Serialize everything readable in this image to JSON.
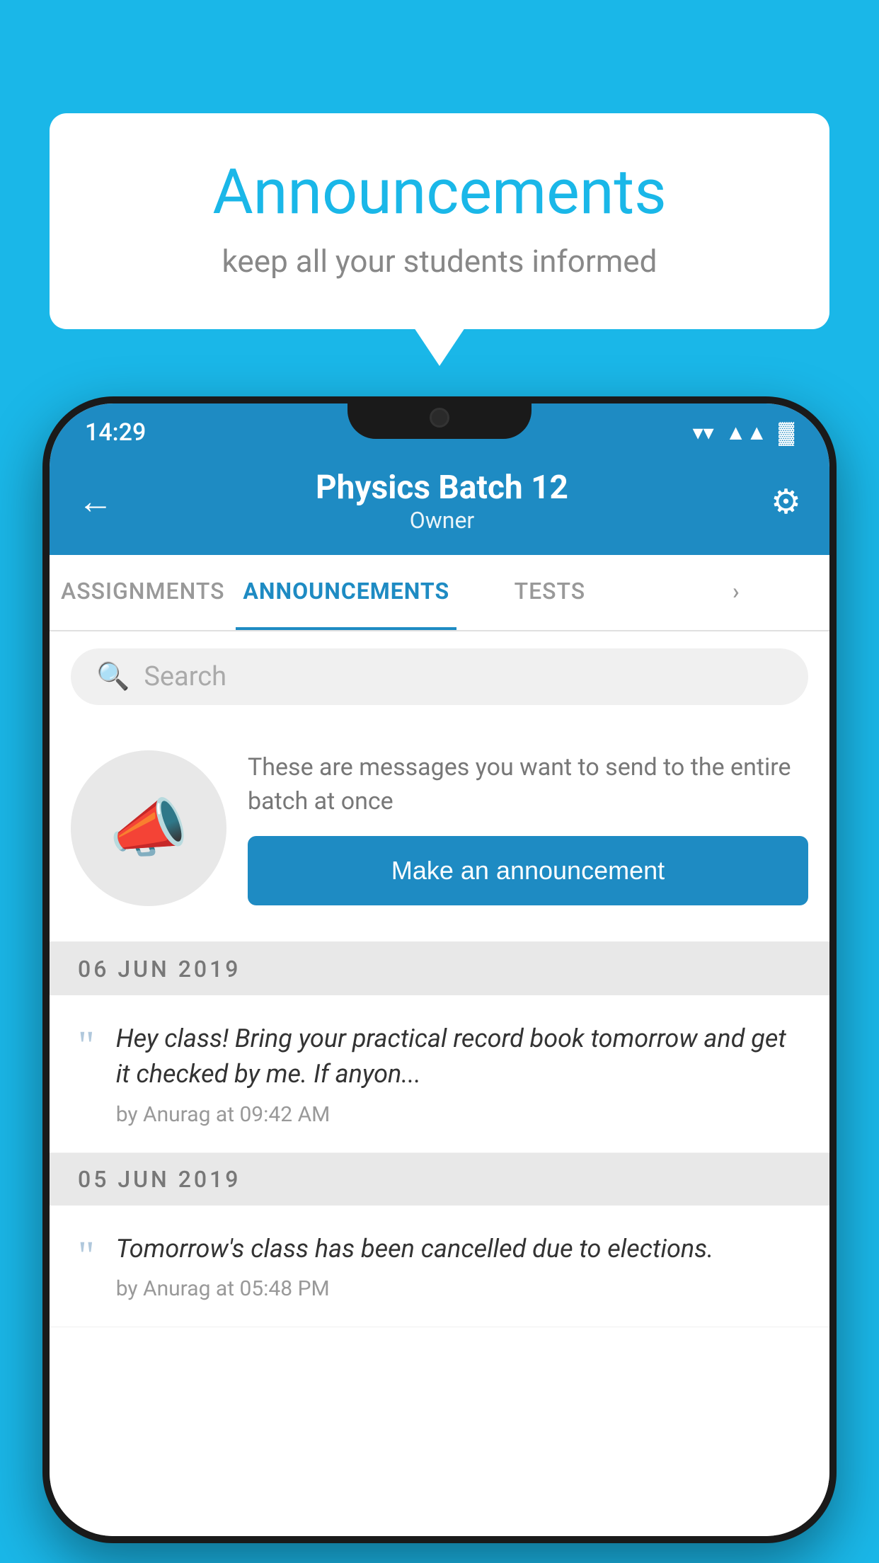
{
  "bubble": {
    "title": "Announcements",
    "subtitle": "keep all your students informed"
  },
  "status": {
    "time": "14:29",
    "wifi": "▼",
    "signal": "▲",
    "battery": "▌"
  },
  "header": {
    "title": "Physics Batch 12",
    "subtitle": "Owner",
    "back_label": "←",
    "gear_label": "⚙"
  },
  "tabs": [
    {
      "label": "ASSIGNMENTS",
      "active": false
    },
    {
      "label": "ANNOUNCEMENTS",
      "active": true
    },
    {
      "label": "TESTS",
      "active": false
    },
    {
      "label": "•",
      "active": false
    }
  ],
  "search": {
    "placeholder": "Search"
  },
  "promo": {
    "description": "These are messages you want to send to the entire batch at once",
    "button_label": "Make an announcement"
  },
  "announcements": [
    {
      "date": "06  JUN  2019",
      "text": "Hey class! Bring your practical record book tomorrow and get it checked by me. If anyon...",
      "meta": "by Anurag at 09:42 AM"
    },
    {
      "date": "05  JUN  2019",
      "text": "Tomorrow's class has been cancelled due to elections.",
      "meta": "by Anurag at 05:48 PM"
    }
  ]
}
